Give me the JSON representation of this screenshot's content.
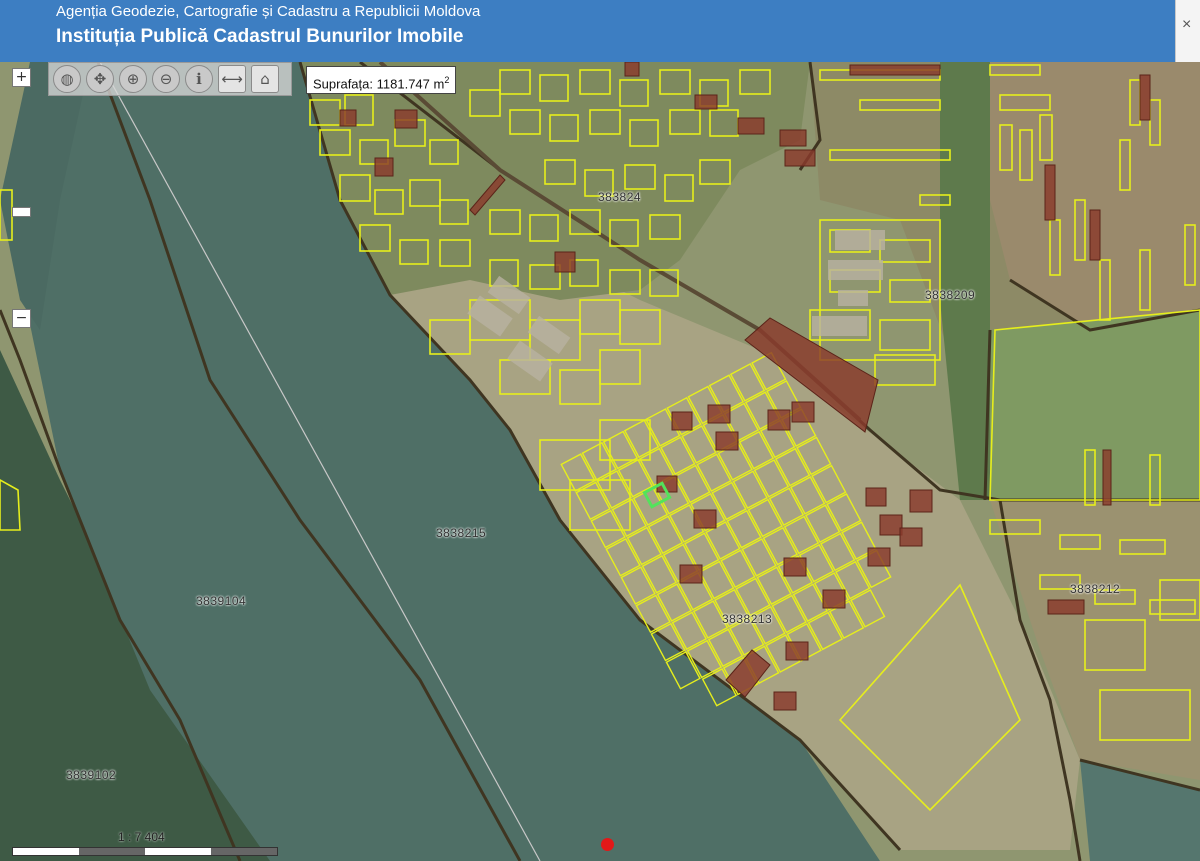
{
  "header": {
    "agency": "Agenția Geodezie, Cartografie și Cadastru a Republicii Moldova",
    "institution": "Instituția Publică Cadastrul Bunurilor Imobile",
    "corner_icon": "×"
  },
  "toolbar": {
    "tools": [
      {
        "name": "globe-icon",
        "glyph": "◍"
      },
      {
        "name": "pan-icon",
        "glyph": "✥"
      },
      {
        "name": "zoom-in-icon",
        "glyph": "⊕"
      },
      {
        "name": "zoom-out-icon",
        "glyph": "⊖"
      },
      {
        "name": "info-icon",
        "glyph": "ℹ"
      },
      {
        "name": "measure-icon",
        "glyph": "⟷"
      },
      {
        "name": "print-icon",
        "glyph": "⌂"
      }
    ]
  },
  "zoom": {
    "plus": "+",
    "minus": "−"
  },
  "measurement": {
    "label": "Suprafața:",
    "value": "1181.747",
    "unit": "m",
    "unit_exp": "2"
  },
  "cadastral_zones": [
    {
      "id": "3838214",
      "text": "383824"
    },
    {
      "id": "3838209",
      "text": "3838209"
    },
    {
      "id": "3838215",
      "text": "3838215"
    },
    {
      "id": "3839104",
      "text": "3839104"
    },
    {
      "id": "3838212",
      "text": "3838212"
    },
    {
      "id": "3838213",
      "text": "3838213"
    },
    {
      "id": "3839102",
      "text": "3839102"
    }
  ],
  "scale": {
    "label": "1 : 7 404"
  },
  "colors": {
    "header": "#3d7ec2",
    "parcel_outline": "#e6ee1c",
    "registered_parcel": "#8a3a2c",
    "selected_parcel": "#53e35b",
    "zone_boundary": "#3f3521",
    "water": "#4f6f66",
    "marker": "#e21818"
  }
}
